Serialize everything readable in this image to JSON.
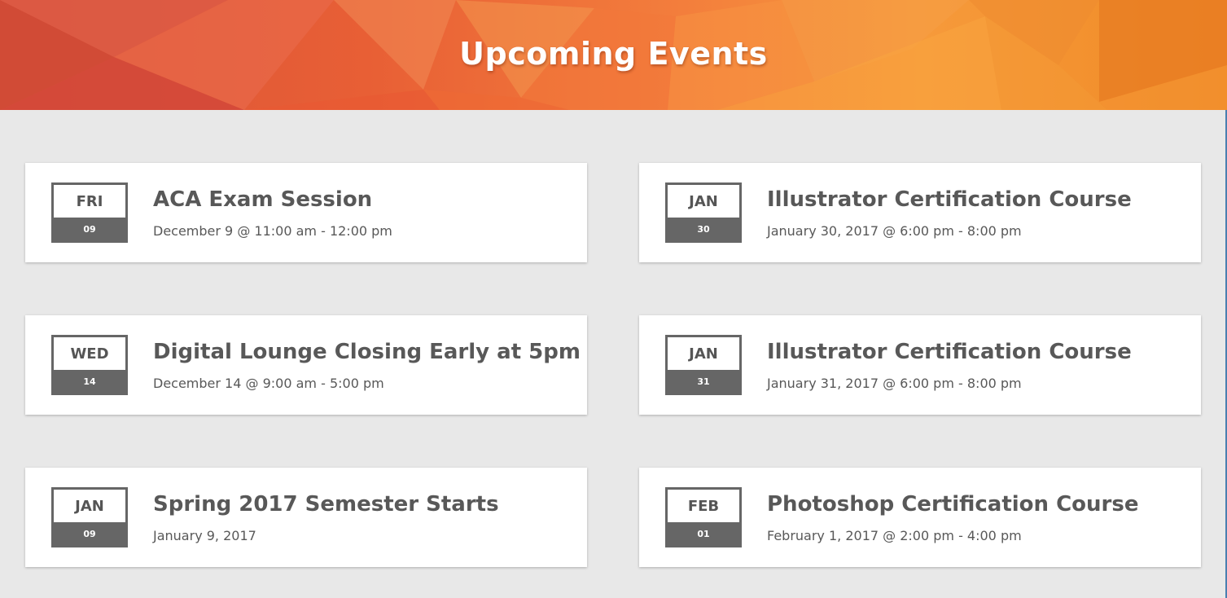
{
  "banner": {
    "title": "Upcoming Events"
  },
  "colors": {
    "accent": "#f37d3c",
    "calendar_dark": "#666666",
    "text": "#585858",
    "background": "#e8e8e8"
  },
  "events": [
    {
      "top": "FRI",
      "bottom": "09",
      "title": "ACA Exam Session",
      "time": "December 9 @ 11:00 am - 12:00 pm"
    },
    {
      "top": "JAN",
      "bottom": "30",
      "title": "Illustrator Certification Course",
      "time": "January 30, 2017 @ 6:00 pm - 8:00 pm"
    },
    {
      "top": "WED",
      "bottom": "14",
      "title": "Digital Lounge Closing Early at 5pm",
      "time": "December 14 @ 9:00 am - 5:00 pm"
    },
    {
      "top": "JAN",
      "bottom": "31",
      "title": "Illustrator Certification Course",
      "time": "January 31, 2017 @ 6:00 pm - 8:00 pm"
    },
    {
      "top": "JAN",
      "bottom": "09",
      "title": "Spring 2017 Semester Starts",
      "time": "January 9, 2017"
    },
    {
      "top": "FEB",
      "bottom": "01",
      "title": "Photoshop Certification Course",
      "time": "February 1, 2017 @ 2:00 pm - 4:00 pm"
    }
  ]
}
